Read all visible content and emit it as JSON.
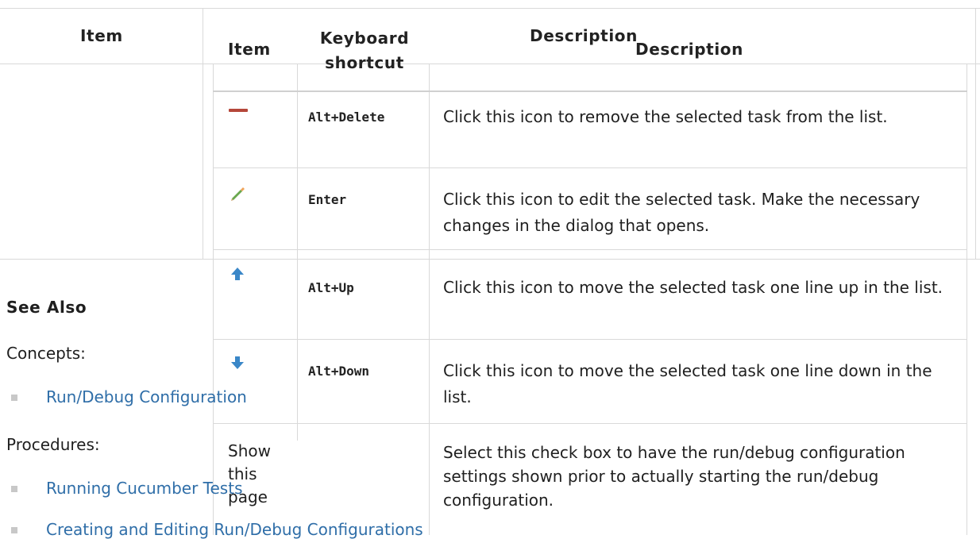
{
  "back_table": {
    "col1_header": "Item",
    "col3_header": "Description"
  },
  "table": {
    "headers": {
      "item": "Item",
      "shortcut": "Keyboard shortcut",
      "description": "Description"
    },
    "rows": [
      {
        "icon": "minus-icon",
        "shortcut": "Alt+Delete",
        "description": "Click this icon to remove the selected task from the list."
      },
      {
        "icon": "pencil-icon",
        "shortcut": "Enter",
        "description": "Click this icon to edit the selected task. Make the necessary changes in the dialog that opens."
      },
      {
        "icon": "arrow-up-icon",
        "shortcut": "Alt+Up",
        "description": "Click this icon to move the selected task one line up in the list."
      },
      {
        "icon": "arrow-down-icon",
        "shortcut": "Alt+Down",
        "description": "Click this icon to move the selected task one line down in the list."
      },
      {
        "item": "Show this page",
        "shortcut": "",
        "description": "Select this check box to have the run/debug configuration settings shown prior to actually starting the run/debug configuration."
      }
    ]
  },
  "see_also": {
    "heading": "See Also",
    "concepts_label": "Concepts:",
    "concepts": [
      "Run/Debug Configuration"
    ],
    "procedures_label": "Procedures:",
    "procedures": [
      "Running Cucumber Tests",
      "Creating and Editing Run/Debug Configurations"
    ]
  },
  "colors": {
    "link": "#2f6ea8",
    "border": "#d9d9d9",
    "minus_icon": "#b5473a",
    "pencil_icon": "#6aa84f",
    "arrow_icon": "#3a87c8"
  }
}
